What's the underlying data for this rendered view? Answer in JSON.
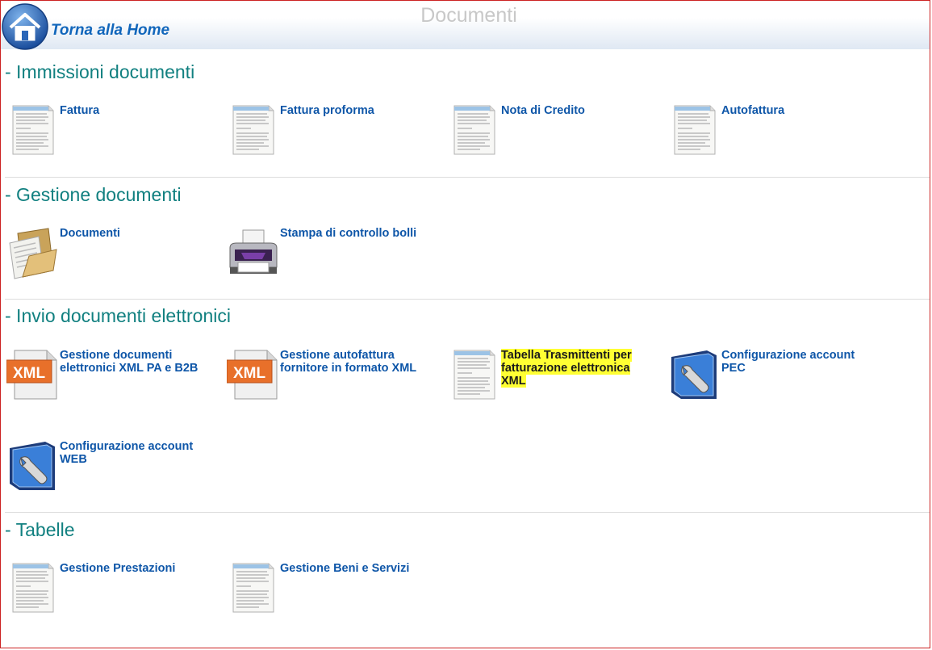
{
  "header": {
    "title": "Documenti",
    "home_label": "Torna alla Home"
  },
  "sections": [
    {
      "title": "- Immissioni documenti",
      "items": [
        {
          "label": "Fattura",
          "icon": "document-icon"
        },
        {
          "label": "Fattura proforma",
          "icon": "document-icon"
        },
        {
          "label": "Nota di Credito",
          "icon": "document-icon"
        },
        {
          "label": "Autofattura",
          "icon": "document-icon"
        }
      ]
    },
    {
      "title": "- Gestione documenti",
      "items": [
        {
          "label": "Documenti",
          "icon": "folder-icon"
        },
        {
          "label": "Stampa di controllo bolli",
          "icon": "printer-icon"
        }
      ]
    },
    {
      "title": "- Invio documenti elettronici",
      "items": [
        {
          "label": "Gestione documenti elettronici XML PA e B2B",
          "icon": "xml-file-icon"
        },
        {
          "label": "Gestione autofattura fornitore in formato XML",
          "icon": "xml-file-icon"
        },
        {
          "label": "Tabella Trasmittenti per fatturazione elettronica XML",
          "icon": "document-icon",
          "highlighted": true
        },
        {
          "label": "Configurazione account PEC",
          "icon": "wrench-settings-icon"
        },
        {
          "label": "Configurazione account WEB",
          "icon": "wrench-settings-icon"
        }
      ]
    },
    {
      "title": "- Tabelle",
      "items": [
        {
          "label": "Gestione Prestazioni",
          "icon": "document-icon"
        },
        {
          "label": "Gestione Beni e Servizi",
          "icon": "document-icon"
        }
      ]
    }
  ],
  "colors": {
    "section_title": "#118080",
    "link": "#0e56a8",
    "highlight": "#ffff33",
    "frame_border": "#cc2222"
  }
}
